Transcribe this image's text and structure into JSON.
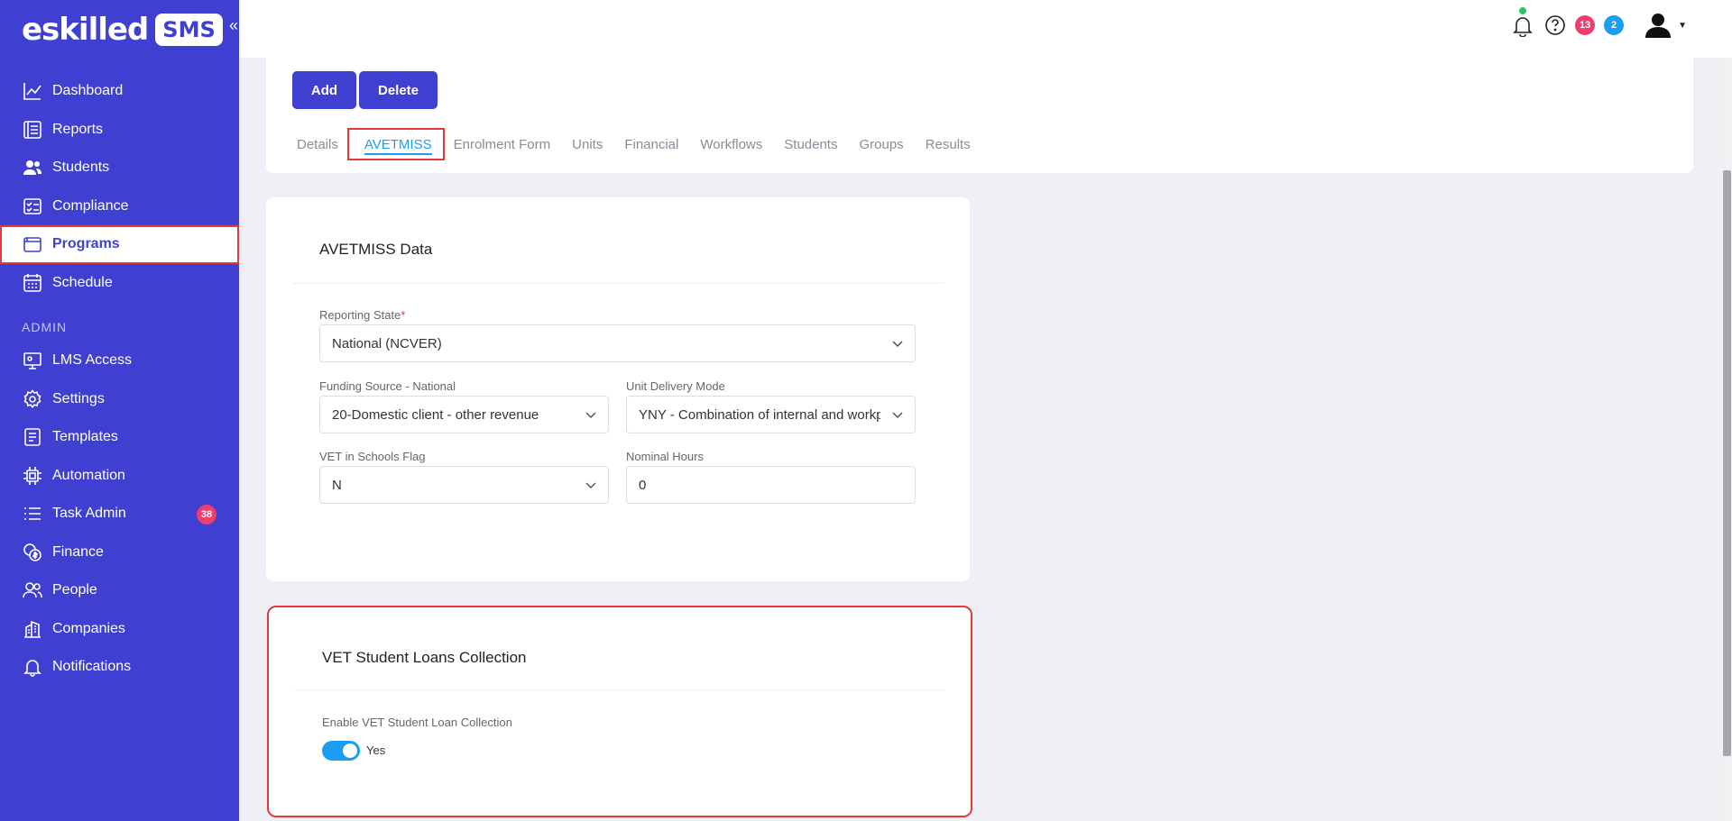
{
  "brand": {
    "name": "eskilled",
    "badge": "SMS"
  },
  "sidebar": {
    "items": [
      {
        "label": "Dashboard",
        "icon": "chart-line-icon"
      },
      {
        "label": "Reports",
        "icon": "report-icon"
      },
      {
        "label": "Students",
        "icon": "users-icon"
      },
      {
        "label": "Compliance",
        "icon": "checklist-icon"
      },
      {
        "label": "Programs",
        "icon": "folder-icon",
        "active": true
      },
      {
        "label": "Schedule",
        "icon": "calendar-icon"
      }
    ],
    "admin_heading": "ADMIN",
    "admin_items": [
      {
        "label": "LMS Access",
        "icon": "monitor-user-icon"
      },
      {
        "label": "Settings",
        "icon": "gear-icon"
      },
      {
        "label": "Templates",
        "icon": "template-icon"
      },
      {
        "label": "Automation",
        "icon": "chip-icon"
      },
      {
        "label": "Task Admin",
        "icon": "list-icon",
        "badge": "38"
      },
      {
        "label": "Finance",
        "icon": "coins-icon"
      },
      {
        "label": "People",
        "icon": "people-icon"
      },
      {
        "label": "Companies",
        "icon": "building-icon"
      },
      {
        "label": "Notifications",
        "icon": "bell-icon"
      }
    ]
  },
  "topbar": {
    "badge_red": "13",
    "badge_blue": "2"
  },
  "actions": {
    "add": "Add",
    "delete": "Delete"
  },
  "tabs": [
    "Details",
    "AVETMISS",
    "Enrolment Form",
    "Units",
    "Financial",
    "Workflows",
    "Students",
    "Groups",
    "Results"
  ],
  "avetmiss": {
    "title": "AVETMISS Data",
    "reporting_state_label": "Reporting State",
    "reporting_state_required": "*",
    "reporting_state_value": "National (NCVER)",
    "funding_label": "Funding Source - National",
    "funding_value": "20-Domestic client - other revenue",
    "delivery_label": "Unit Delivery Mode",
    "delivery_value": "YNY - Combination of internal and workplace-based delivery",
    "vet_flag_label": "VET in Schools Flag",
    "vet_flag_value": "N",
    "hours_label": "Nominal Hours",
    "hours_value": "0"
  },
  "vet_loans": {
    "title": "VET Student Loans Collection",
    "enable_label": "Enable VET Student Loan Collection",
    "toggle_value": "Yes",
    "enabled": true
  },
  "colors": {
    "sidebar": "#3f3fd1",
    "accent": "#1b9ef2",
    "highlight": "#e33b3b"
  }
}
